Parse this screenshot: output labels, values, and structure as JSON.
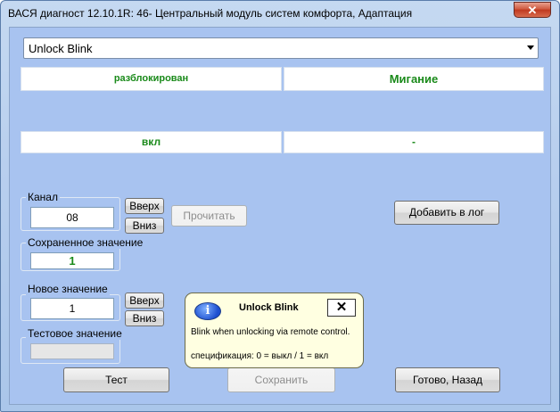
{
  "window": {
    "title": "ВАСЯ диагност 12.10.1R: 46- Центральный модуль систем комфорта, Адаптация",
    "close_glyph": "✕"
  },
  "channel_select": {
    "selected": "Unlock Blink"
  },
  "values": {
    "row1_left": "разблокирован",
    "row1_right": "Мигание",
    "row2_left": "вкл",
    "row2_right": "-"
  },
  "channel": {
    "label": "Канал",
    "value": "08",
    "up": "Вверх",
    "down": "Вниз",
    "read": "Прочитать"
  },
  "saved": {
    "label": "Сохраненное значение",
    "value": "1"
  },
  "new_value": {
    "label": "Новое значение",
    "value": "1",
    "up": "Вверх",
    "down": "Вниз"
  },
  "test_value": {
    "label": "Тестовое значение",
    "value": ""
  },
  "buttons": {
    "add_log": "Добавить в лог",
    "test": "Тест",
    "save": "Сохранить",
    "done": "Готово, Назад"
  },
  "tooltip": {
    "title": "Unlock Blink",
    "icon": "i",
    "close_glyph": "✕",
    "body": "Blink when unlocking via remote control.",
    "spec": "спецификация: 0 = выкл / 1 = вкл"
  }
}
